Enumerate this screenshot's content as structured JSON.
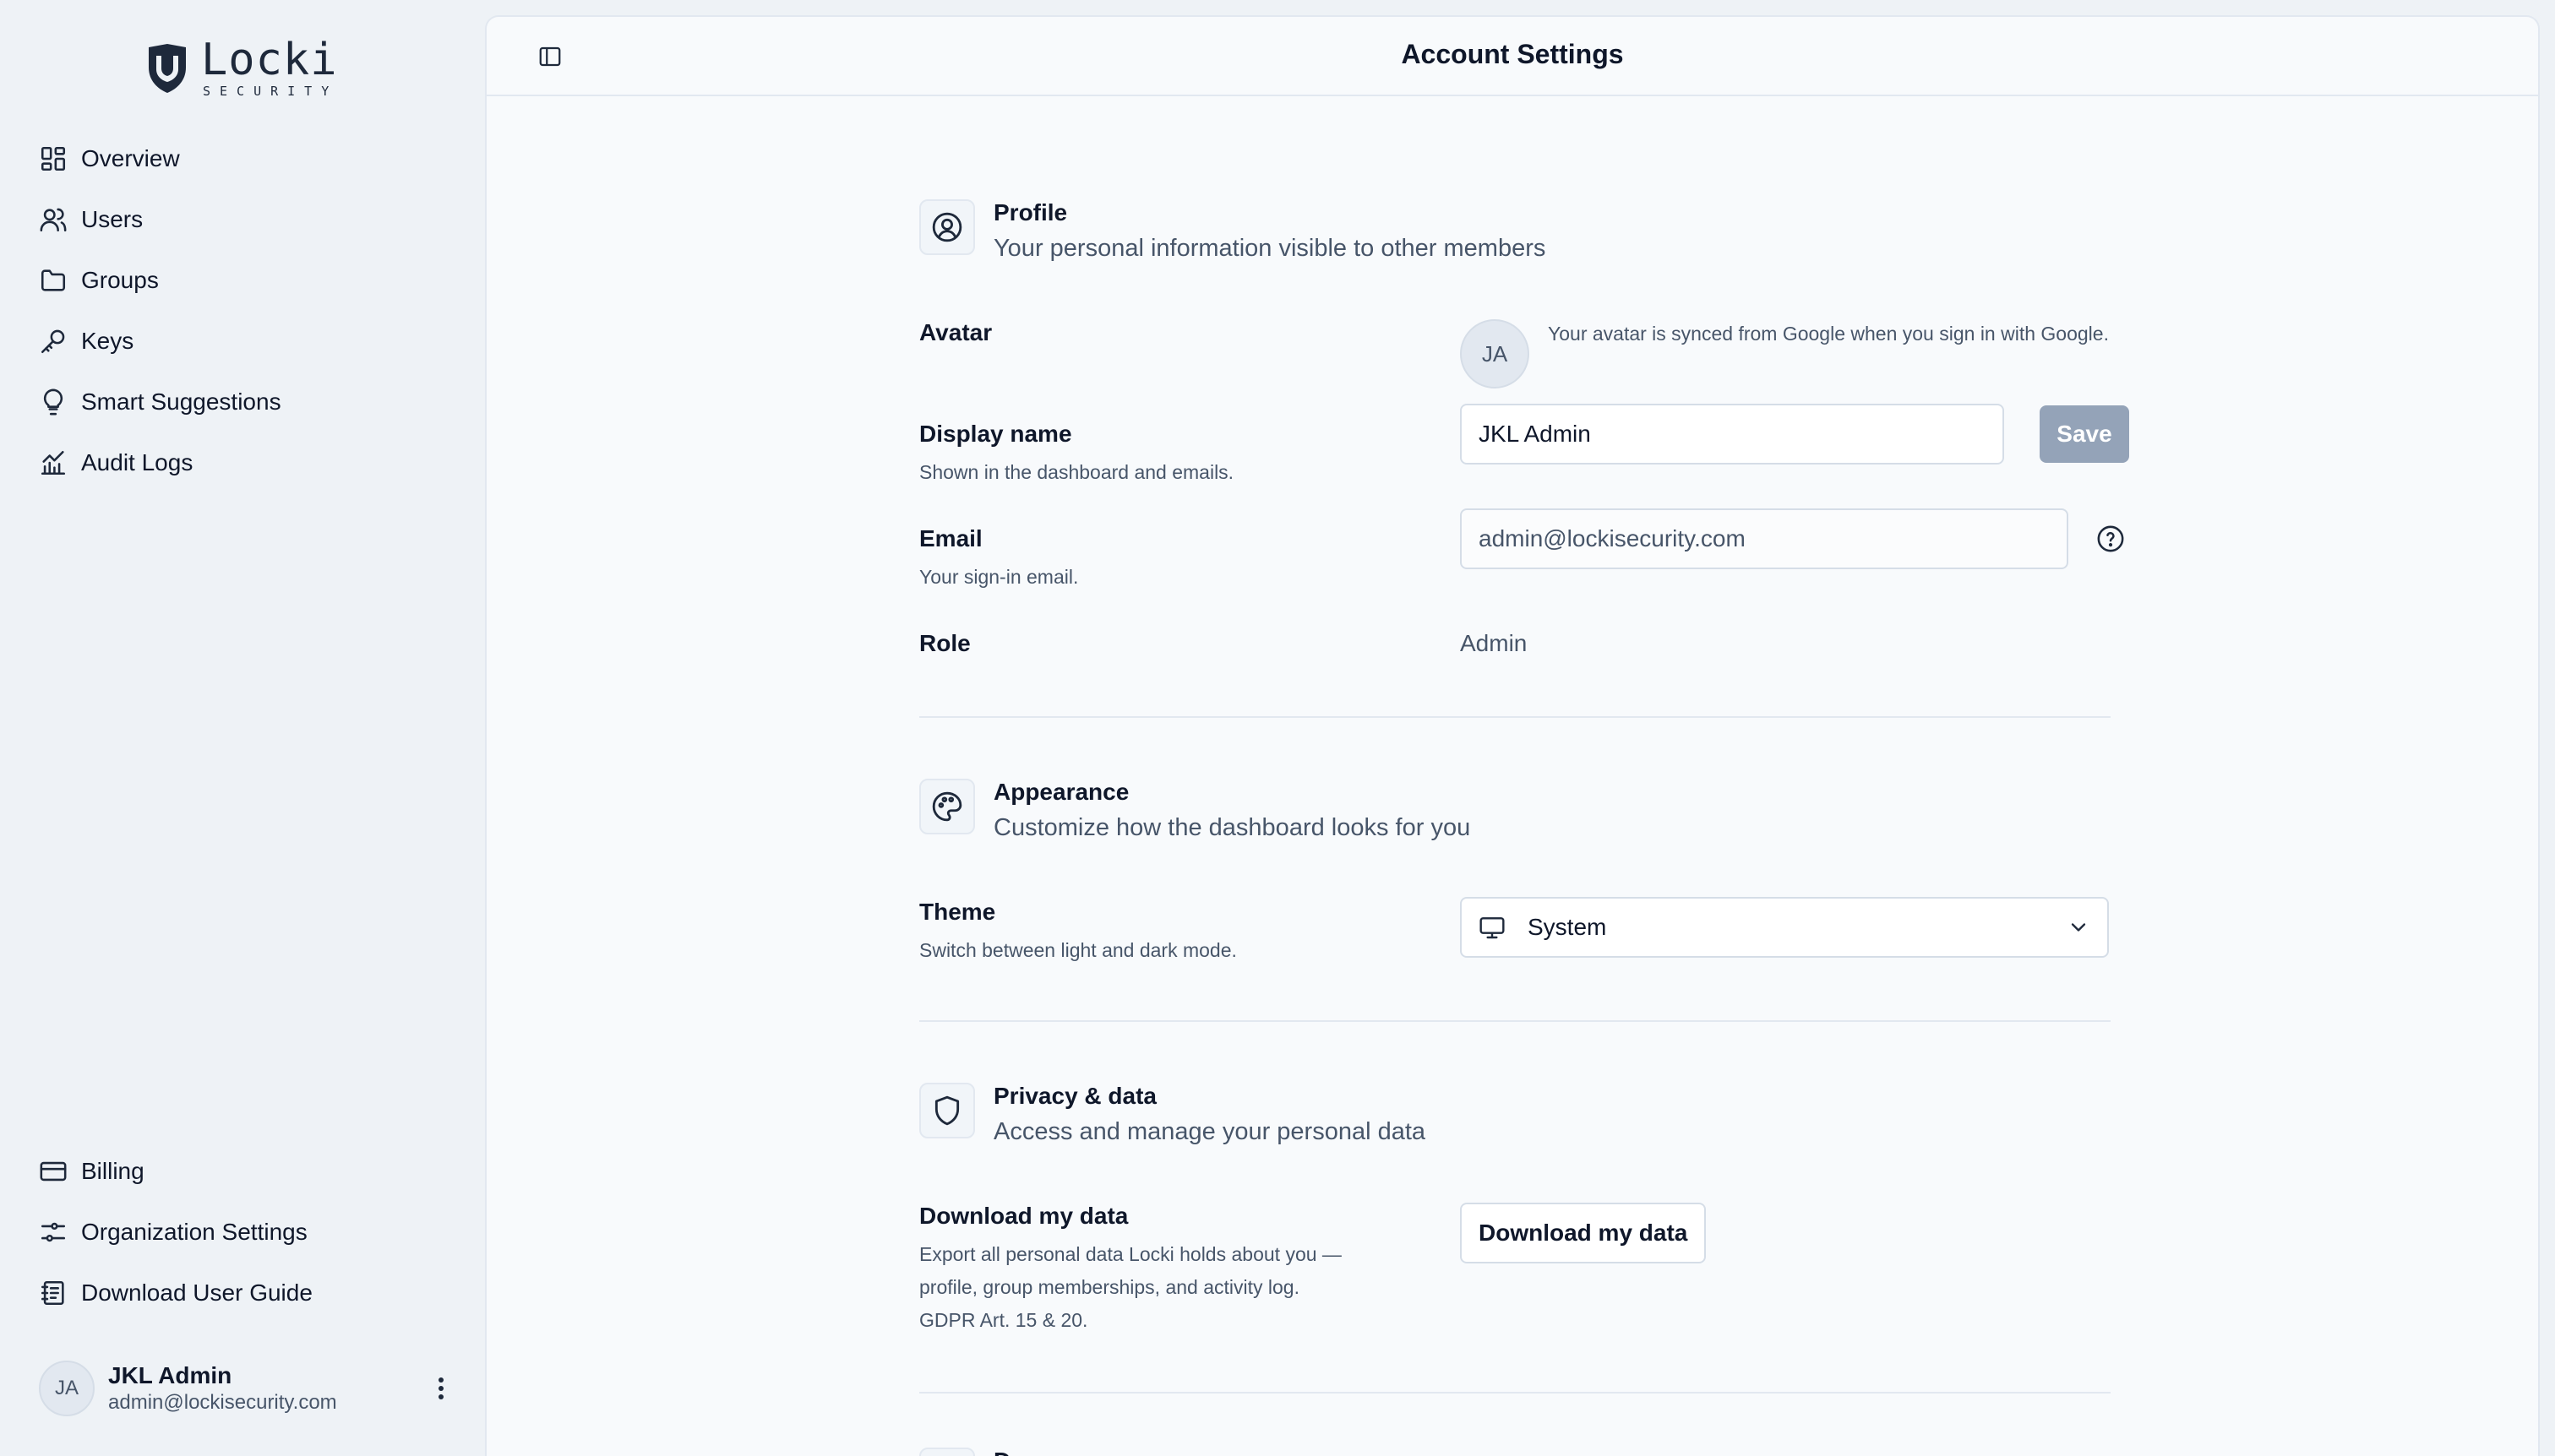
{
  "brand": {
    "name": "Locki",
    "tagline": "SECURITY"
  },
  "sidebar": {
    "items": [
      {
        "label": "Overview",
        "icon": "dashboard-icon"
      },
      {
        "label": "Users",
        "icon": "users-icon"
      },
      {
        "label": "Groups",
        "icon": "folder-icon"
      },
      {
        "label": "Keys",
        "icon": "key-icon"
      },
      {
        "label": "Smart Suggestions",
        "icon": "lightbulb-icon"
      },
      {
        "label": "Audit Logs",
        "icon": "chart-icon"
      }
    ],
    "footer_items": [
      {
        "label": "Billing",
        "icon": "credit-card-icon"
      },
      {
        "label": "Organization Settings",
        "icon": "sliders-icon"
      },
      {
        "label": "Download User Guide",
        "icon": "book-icon"
      }
    ],
    "user": {
      "initials": "JA",
      "name": "JKL Admin",
      "email": "admin@lockisecurity.com"
    }
  },
  "header": {
    "title": "Account Settings"
  },
  "profile": {
    "title": "Profile",
    "subtitle": "Your personal information visible to other members",
    "avatar": {
      "label": "Avatar",
      "initials": "JA",
      "note": "Your avatar is synced from Google when you sign in with Google."
    },
    "display_name": {
      "label": "Display name",
      "help": "Shown in the dashboard and emails.",
      "value": "JKL Admin",
      "save_label": "Save"
    },
    "email": {
      "label": "Email",
      "help": "Your sign-in email.",
      "value": "admin@lockisecurity.com"
    },
    "role": {
      "label": "Role",
      "value": "Admin"
    }
  },
  "appearance": {
    "title": "Appearance",
    "subtitle": "Customize how the dashboard looks for you",
    "theme": {
      "label": "Theme",
      "help": "Switch between light and dark mode.",
      "selected": "System"
    }
  },
  "privacy": {
    "title": "Privacy & data",
    "subtitle": "Access and manage your personal data",
    "download": {
      "label": "Download my data",
      "help": "Export all personal data Locki holds about you — profile, group memberships, and activity log. GDPR Art. 15 & 20.",
      "button_label": "Download my data"
    }
  },
  "danger": {
    "title": "Danger zone"
  },
  "colors": {
    "save_disabled": "#94a3b8",
    "text": "#0f172a",
    "muted": "#475569",
    "border": "#d5dde7"
  }
}
